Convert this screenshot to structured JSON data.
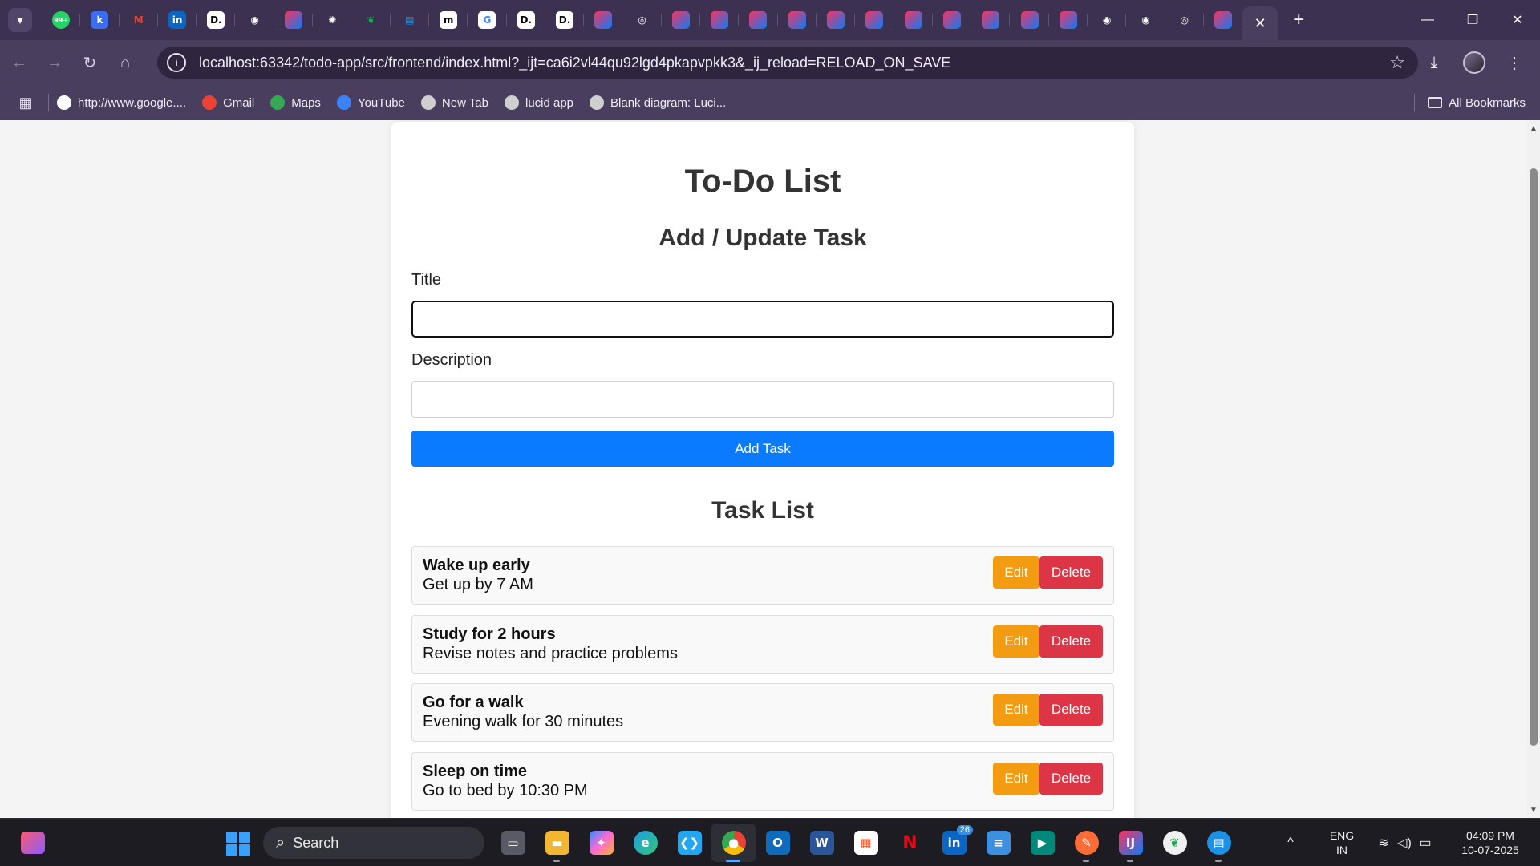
{
  "browser": {
    "url": "localhost:63342/todo-app/src/frontend/index.html?_ijt=ca6i2vl44qu92lgd4pkapvpkk3&_ij_reload=RELOAD_ON_SAVE",
    "tab_favicons": [
      "whatsapp-icon",
      "k-app-icon",
      "gmail-icon",
      "linkedin-icon",
      "dev-icon",
      "github-icon",
      "jetbrains-icon",
      "openai-icon",
      "mongodb-icon",
      "docker-icon",
      "medium-icon",
      "google-icon",
      "dev-icon",
      "dev-icon",
      "jetbrains-icon",
      "chrome-icon",
      "jetbrains-icon",
      "jetbrains-icon",
      "jetbrains-icon",
      "jetbrains-icon",
      "jetbrains-icon",
      "jetbrains-icon",
      "jetbrains-icon",
      "jetbrains-icon",
      "jetbrains-icon",
      "jetbrains-icon",
      "jetbrains-icon",
      "github-icon",
      "github-icon",
      "chrome-icon",
      "jetbrains-icon"
    ],
    "whatsapp_badge": "99+",
    "bookmarks": [
      {
        "label": "http://www.google....",
        "icon": "google-icon",
        "color": "#ffffff"
      },
      {
        "label": "Gmail",
        "icon": "gmail-icon",
        "color": "#ea4335"
      },
      {
        "label": "Maps",
        "icon": "maps-icon",
        "color": "#34a853"
      },
      {
        "label": "YouTube",
        "icon": "youtube-icon",
        "color": "#3b82f6"
      },
      {
        "label": "New Tab",
        "icon": "globe-icon",
        "color": "#cfcfcf"
      },
      {
        "label": "lucid app",
        "icon": "globe-icon",
        "color": "#cfcfcf"
      },
      {
        "label": "Blank diagram: Luci...",
        "icon": "globe-icon",
        "color": "#cfcfcf"
      }
    ],
    "all_bookmarks": "All Bookmarks"
  },
  "app": {
    "title": "To-Do List",
    "form_heading": "Add / Update Task",
    "title_label": "Title",
    "title_value": "",
    "description_label": "Description",
    "description_value": "",
    "add_button": "Add Task",
    "list_heading": "Task List",
    "edit_label": "Edit",
    "delete_label": "Delete",
    "tasks": [
      {
        "title": "Wake up early",
        "description": "Get up by 7 AM"
      },
      {
        "title": "Study for 2 hours",
        "description": "Revise notes and practice problems"
      },
      {
        "title": "Go for a walk",
        "description": "Evening walk for 30 minutes"
      },
      {
        "title": "Sleep on time",
        "description": "Go to bed by 10:30 PM"
      }
    ]
  },
  "colors": {
    "primary": "#0a7bff",
    "edit": "#f39c12",
    "delete": "#dc3545",
    "chrome_dark": "#3c3150"
  },
  "taskbar": {
    "search_label": "Search",
    "linkedin_badge": "26",
    "language": "ENG",
    "region": "IN",
    "time": "04:09 PM",
    "date": "10-07-2025"
  }
}
